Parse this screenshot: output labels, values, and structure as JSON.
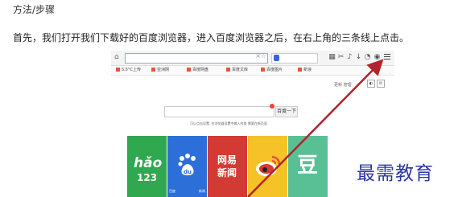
{
  "doc": {
    "heading": "方法/步骤",
    "instruction": "首先，我们打开我们下载好的百度浏览器，进入百度浏览器之后，在右上角的三条线上点击。"
  },
  "browser": {
    "utility_text": "更新 管理",
    "search_button": "百度一下",
    "hint": "可以点击设置, 在浏览器设置中输入检查  需要在新页面"
  },
  "tiles": [
    {
      "name": "hao123",
      "line1": "hǎo",
      "line2": "123",
      "color": "#2fa84f"
    },
    {
      "name": "baidu",
      "line1": "du",
      "caption": "百度",
      "caption2": "新闻",
      "color": "#2d6fd9"
    },
    {
      "name": "wangyi",
      "line1": "网易",
      "line2": "新闻",
      "color": "#d33a34"
    },
    {
      "name": "weibo",
      "color": "#f5c227"
    },
    {
      "name": "douban",
      "line1": "豆",
      "color": "#59c095"
    }
  ],
  "watermark": "最需教育",
  "colors": {
    "arrow": "#b0242e",
    "watermark": "#2b37a6"
  }
}
